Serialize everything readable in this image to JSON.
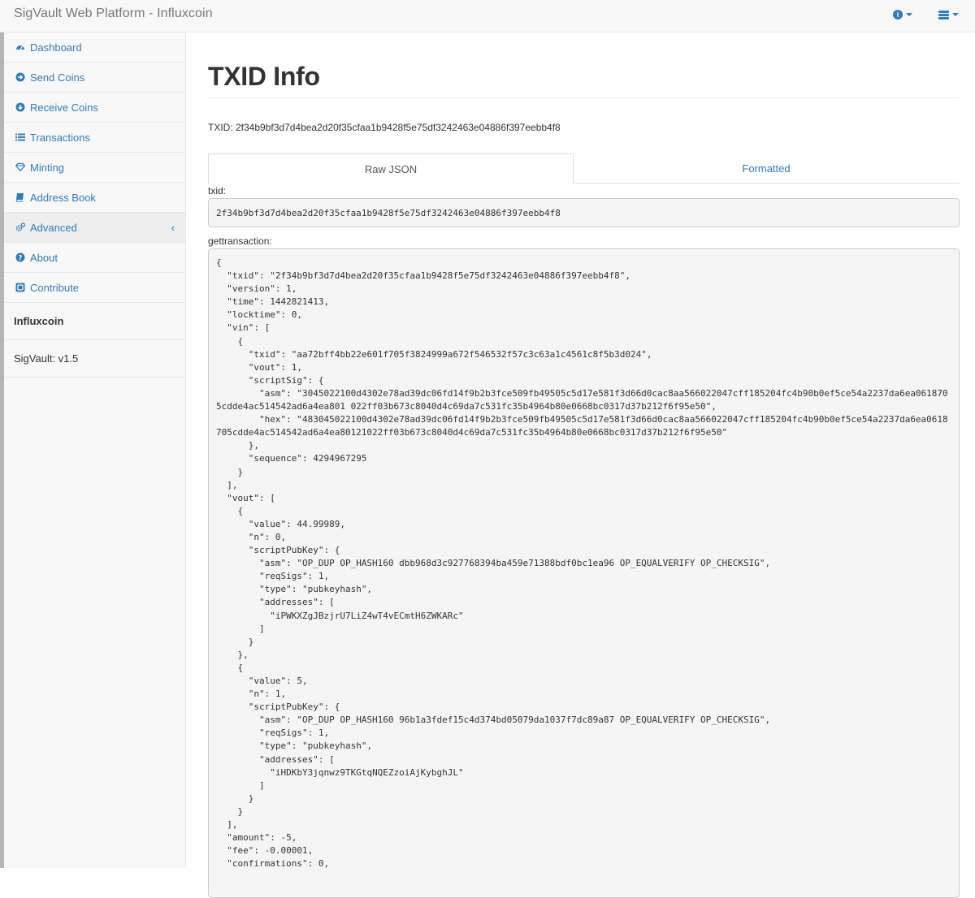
{
  "header": {
    "brand": "SigVault Web Platform - Influxcoin",
    "info_icon": "info-circle-icon",
    "menu_icon": "list-icon"
  },
  "sidebar": {
    "items": [
      {
        "label": "Dashboard",
        "icon": "dashboard-icon"
      },
      {
        "label": "Send Coins",
        "icon": "arrow-circle-right-icon"
      },
      {
        "label": "Receive Coins",
        "icon": "arrow-circle-down-icon"
      },
      {
        "label": "Transactions",
        "icon": "list-icon"
      },
      {
        "label": "Minting",
        "icon": "diamond-icon"
      },
      {
        "label": "Address Book",
        "icon": "book-icon"
      },
      {
        "label": "Advanced",
        "icon": "cogs-icon",
        "chevron": "‹"
      },
      {
        "label": "About",
        "icon": "question-circle-icon"
      },
      {
        "label": "Contribute",
        "icon": "contribute-icon"
      }
    ],
    "coin_name": "Influxcoin",
    "version": "SigVault: v1.5"
  },
  "main": {
    "title": "TXID Info",
    "txid_line": "TXID: 2f34b9bf3d7d4bea2d20f35cfaa1b9428f5e75df3242463e04886f397eebb4f8",
    "tabs": [
      {
        "label": "Raw JSON",
        "active": true
      },
      {
        "label": "Formatted",
        "active": false
      }
    ],
    "txid_label": "txid:",
    "txid_value": "2f34b9bf3d7d4bea2d20f35cfaa1b9428f5e75df3242463e04886f397eebb4f8",
    "gettransaction_label": "gettransaction:",
    "gettransaction_json": "{\n  \"txid\": \"2f34b9bf3d7d4bea2d20f35cfaa1b9428f5e75df3242463e04886f397eebb4f8\",\n  \"version\": 1,\n  \"time\": 1442821413,\n  \"locktime\": 0,\n  \"vin\": [\n    {\n      \"txid\": \"aa72bff4bb22e601f705f3824999a672f546532f57c3c63a1c4561c8f5b3d024\",\n      \"vout\": 1,\n      \"scriptSig\": {\n        \"asm\": \"3045022100d4302e78ad39dc06fd14f9b2b3fce509fb49505c5d17e581f3d66d0cac8aa566022047cff185204fc4b90b0ef5ce54a2237da6ea0618705cdde4ac514542ad6a4ea801 022ff03b673c8040d4c69da7c531fc35b4964b80e0668bc0317d37b212f6f95e50\",\n        \"hex\": \"483045022100d4302e78ad39dc06fd14f9b2b3fce509fb49505c5d17e581f3d66d0cac8aa566022047cff185204fc4b90b0ef5ce54a2237da6ea0618705cdde4ac514542ad6a4ea80121022ff03b673c8040d4c69da7c531fc35b4964b80e0668bc0317d37b212f6f95e50\"\n      },\n      \"sequence\": 4294967295\n    }\n  ],\n  \"vout\": [\n    {\n      \"value\": 44.99989,\n      \"n\": 0,\n      \"scriptPubKey\": {\n        \"asm\": \"OP_DUP OP_HASH160 dbb968d3c927768394ba459e71388bdf0bc1ea96 OP_EQUALVERIFY OP_CHECKSIG\",\n        \"reqSigs\": 1,\n        \"type\": \"pubkeyhash\",\n        \"addresses\": [\n          \"iPWKXZgJBzjrU7LiZ4wT4vECmtH6ZWKARc\"\n        ]\n      }\n    },\n    {\n      \"value\": 5,\n      \"n\": 1,\n      \"scriptPubKey\": {\n        \"asm\": \"OP_DUP OP_HASH160 96b1a3fdef15c4d374bd05079da1037f7dc89a87 OP_EQUALVERIFY OP_CHECKSIG\",\n        \"reqSigs\": 1,\n        \"type\": \"pubkeyhash\",\n        \"addresses\": [\n          \"iHDKbY3jqnwz9TKGtqNQEZzoiAjKybghJL\"\n        ]\n      }\n    }\n  ],\n  \"amount\": -5,\n  \"fee\": -0.00001,\n  \"confirmations\": 0,"
  },
  "colors": {
    "link": "#337ab7",
    "sidebar_bg": "#f8f8f8",
    "code_bg": "#f5f5f5"
  }
}
